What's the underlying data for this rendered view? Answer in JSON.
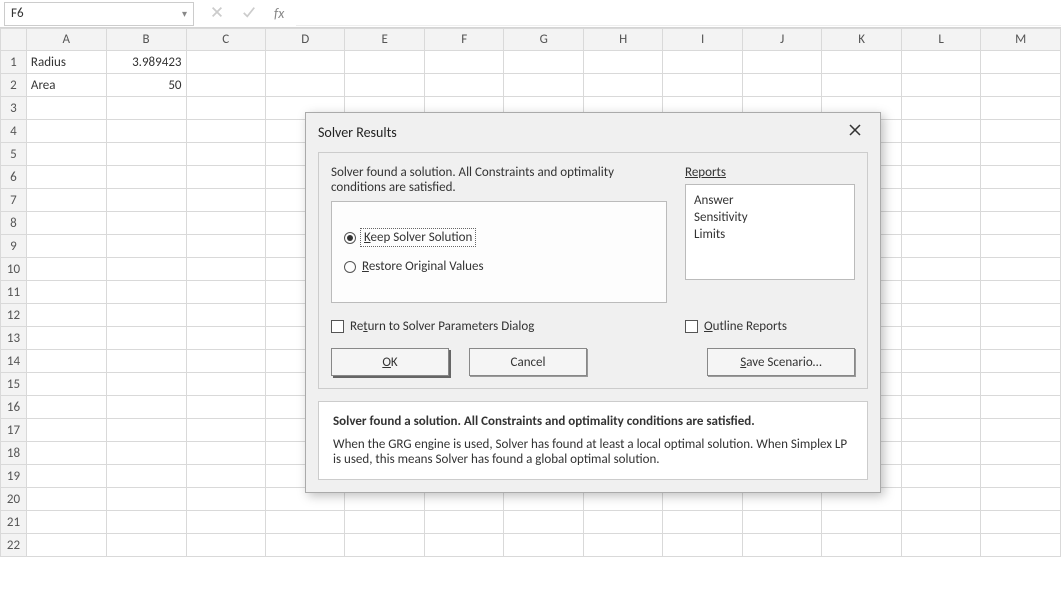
{
  "namebox": {
    "value": "F6"
  },
  "fbar": {
    "fx": "fx"
  },
  "columns": [
    "A",
    "B",
    "C",
    "D",
    "E",
    "F",
    "G",
    "H",
    "I",
    "J",
    "K",
    "L",
    "M"
  ],
  "rows": [
    "1",
    "2",
    "3",
    "4",
    "5",
    "6",
    "7",
    "8",
    "9",
    "10",
    "11",
    "12",
    "13",
    "14",
    "15",
    "16",
    "17",
    "18",
    "19",
    "20",
    "21",
    "22"
  ],
  "active": {
    "col": "F",
    "row": "6"
  },
  "cells": {
    "A1": "Radius",
    "B1": "3.989423",
    "A2": "Area",
    "B2": "50"
  },
  "dialog": {
    "title": "Solver Results",
    "status": "Solver found a solution.  All Constraints and optimality conditions are satisfied.",
    "radios": {
      "keep": "Keep Solver Solution",
      "restore": "Restore Original Values"
    },
    "reports_label": "Reports",
    "reports": [
      "Answer",
      "Sensitivity",
      "Limits"
    ],
    "checks": {
      "return": "Return to Solver Parameters Dialog",
      "outline": "Outline Reports"
    },
    "buttons": {
      "ok": "OK",
      "cancel": "Cancel",
      "save": "Save Scenario…"
    },
    "info_title": "Solver found a solution.  All Constraints and optimality conditions are satisfied.",
    "info_body": "When the GRG engine is used, Solver has found at least a local optimal solution. When Simplex LP is used, this means Solver has found a global optimal solution."
  }
}
